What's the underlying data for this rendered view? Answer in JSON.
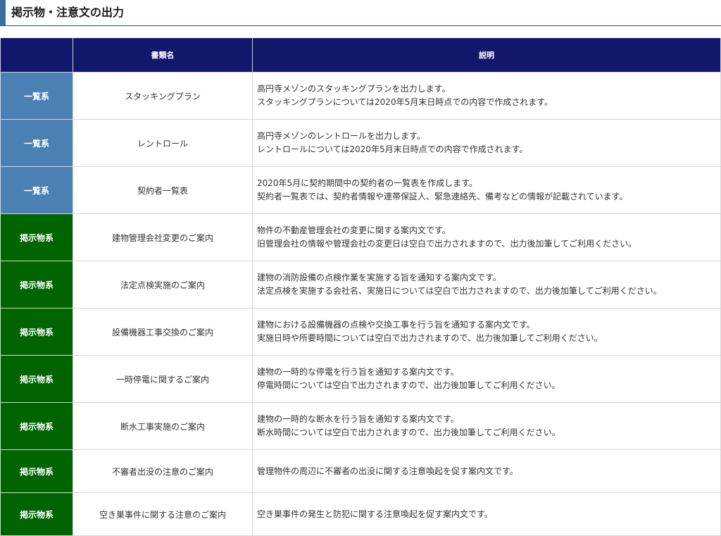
{
  "page": {
    "heading": "掲示物・注意文の出力"
  },
  "table": {
    "headers": [
      "",
      "書類名",
      "説明"
    ],
    "rows": [
      {
        "category": "一覧系",
        "category_type": "list",
        "name": "スタッキングプラン",
        "description": [
          "高円寺メゾンのスタッキングプランを出力します。",
          "スタッキングプランについては2020年5月末日時点での内容で作成されます。"
        ]
      },
      {
        "category": "一覧系",
        "category_type": "list",
        "name": "レントロール",
        "description": [
          "高円寺メゾンのレントロールを出力します。",
          "レントロールについては2020年5月末日時点での内容で作成されます。"
        ]
      },
      {
        "category": "一覧系",
        "category_type": "list",
        "name": "契約者一覧表",
        "description": [
          "2020年5月に契約期間中の契約者の一覧表を作成します。",
          "契約者一覧表では、契約者情報や連帯保証人、緊急連絡先、備考などの情報が記載されています。"
        ]
      },
      {
        "category": "掲示物系",
        "category_type": "notice",
        "name": "建物管理会社変更のご案内",
        "description": [
          "物件の不動産管理会社の変更に関する案内文です。",
          "旧管理会社の情報や管理会社の変更日は空白で出力されますので、出力後加筆してご利用ください。"
        ]
      },
      {
        "category": "掲示物系",
        "category_type": "notice",
        "name": "法定点検実施のご案内",
        "description": [
          "建物の消防設備の点検作業を実施する旨を通知する案内文です。",
          "法定点検を実施する会社名、実施日については空白で出力されますので、出力後加筆してご利用ください。"
        ]
      },
      {
        "category": "掲示物系",
        "category_type": "notice",
        "name": "設備機器工事交換のご案内",
        "description": [
          "建物における設備機器の点検や交換工事を行う旨を通知する案内文です。",
          "実施日時や所要時間については空白で出力されますので、出力後加筆してご利用ください。"
        ]
      },
      {
        "category": "掲示物系",
        "category_type": "notice",
        "name": "一時停電に関するご案内",
        "description": [
          "建物の一時的な停電を行う旨を通知する案内文です。",
          "停電時間については空白で出力されますので、出力後加筆してご利用ください。"
        ]
      },
      {
        "category": "掲示物系",
        "category_type": "notice",
        "name": "断水工事実施のご案内",
        "description": [
          "建物の一時的な断水を行う旨を通知する案内文です。",
          "断水時間については空白で出力されますので、出力後加筆してご利用ください。"
        ]
      },
      {
        "category": "掲示物系",
        "category_type": "notice",
        "name": "不審者出没の注意のご案内",
        "description": [
          "管理物件の周辺に不審者の出没に関する注意喚起を促す案内文です。"
        ]
      },
      {
        "category": "掲示物系",
        "category_type": "notice",
        "name": "空き巣事件に関する注意のご案内",
        "description": [
          "空き巣事件の発生と防犯に関する注意喚起を促す案内文です。"
        ]
      }
    ]
  },
  "colors": {
    "header_bg": "#13176b",
    "list_category": "#4a80b4",
    "notice_category": "#006400"
  }
}
